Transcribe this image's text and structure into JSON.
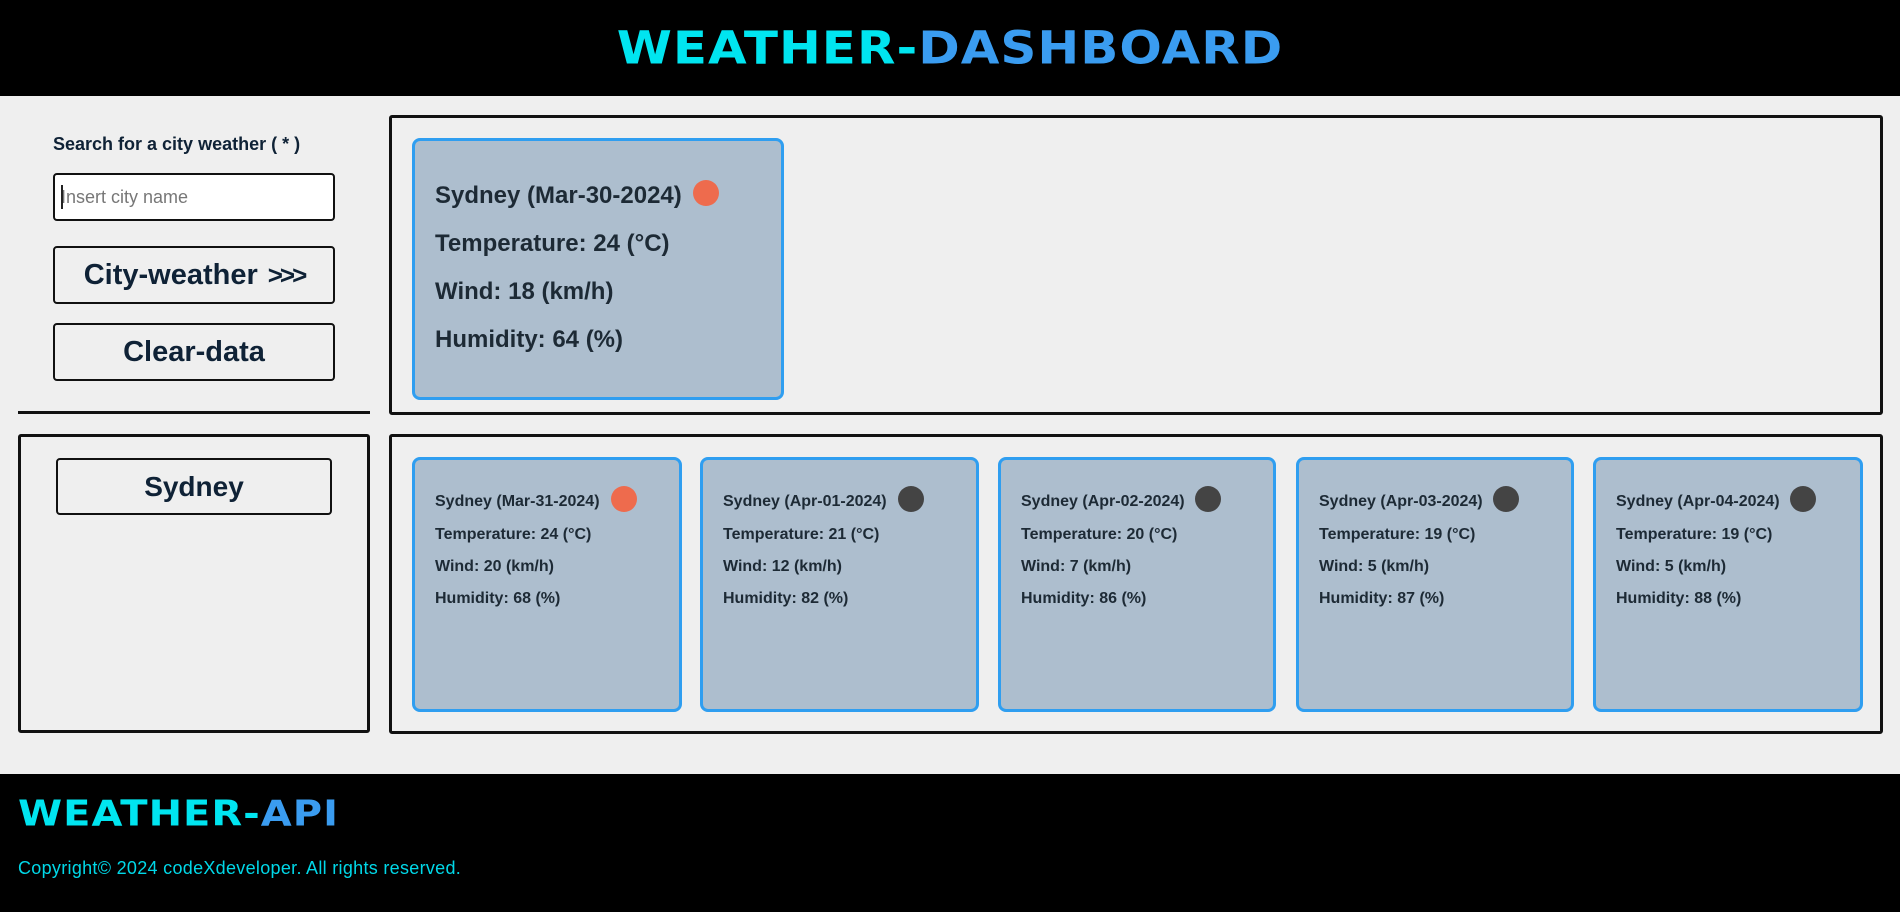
{
  "header": {
    "brand_part1": "WEATHER-",
    "brand_part2": "DASHBOARD"
  },
  "search": {
    "label": "Search for a city weather ( * )",
    "placeholder": "Insert city name",
    "value": "",
    "weather_button": "City-weather",
    "weather_button_icon": ">>>",
    "clear_button": "Clear-data"
  },
  "history": {
    "items": [
      {
        "label": "Sydney"
      }
    ]
  },
  "current": {
    "title": "Sydney (Mar-30-2024)",
    "icon_color": "#ee6b4d",
    "temperature": "Temperature: 24 (°C)",
    "wind": "Wind: 18 (km/h)",
    "humidity": "Humidity: 64 (%)"
  },
  "forecast": [
    {
      "title": "Sydney (Mar-31-2024)",
      "icon_color": "#ee6b4d",
      "temperature": "Temperature: 24 (°C)",
      "wind": "Wind: 20 (km/h)",
      "humidity": "Humidity: 68 (%)"
    },
    {
      "title": "Sydney (Apr-01-2024)",
      "icon_color": "#444444",
      "temperature": "Temperature: 21 (°C)",
      "wind": "Wind: 12 (km/h)",
      "humidity": "Humidity: 82 (%)"
    },
    {
      "title": "Sydney (Apr-02-2024)",
      "icon_color": "#444444",
      "temperature": "Temperature: 20 (°C)",
      "wind": "Wind: 7 (km/h)",
      "humidity": "Humidity: 86 (%)"
    },
    {
      "title": "Sydney (Apr-03-2024)",
      "icon_color": "#444444",
      "temperature": "Temperature: 19 (°C)",
      "wind": "Wind: 5 (km/h)",
      "humidity": "Humidity: 87 (%)"
    },
    {
      "title": "Sydney (Apr-04-2024)",
      "icon_color": "#444444",
      "temperature": "Temperature: 19 (°C)",
      "wind": "Wind: 5 (km/h)",
      "humidity": "Humidity: 88 (%)"
    }
  ],
  "footer": {
    "brand_part1": "WEATHER-",
    "brand_part2": "API",
    "copyright": "Copyright© 2024 codeXdeveloper. All rights reserved."
  },
  "colors": {
    "header_bg": "#000000",
    "brand_cyan": "#00e5f0",
    "brand_blue": "#3a9cf0",
    "card_bg": "#adbece",
    "card_border": "#2f9ef0",
    "page_bg": "#efefef"
  }
}
